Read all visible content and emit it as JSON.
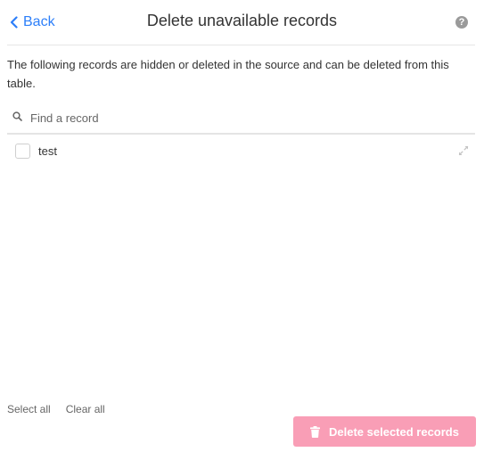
{
  "header": {
    "back_label": "Back",
    "title": "Delete unavailable records",
    "help_glyph": "?"
  },
  "description": "The following records are hidden or deleted in the source and can be deleted from this table.",
  "search": {
    "placeholder": "Find a record",
    "value": ""
  },
  "records": [
    {
      "name": "test",
      "checked": false
    }
  ],
  "footer": {
    "select_all_label": "Select all",
    "clear_all_label": "Clear all",
    "delete_label": "Delete selected records"
  },
  "colors": {
    "accent": "#2d7ff9",
    "delete_button": "#f99eb6",
    "text": "#333333",
    "muted": "#666666"
  },
  "icons": {
    "back": "chevron-left-icon",
    "help": "question-circle-icon",
    "search": "search-icon",
    "expand": "expand-arrows-icon",
    "delete": "trash-icon"
  }
}
